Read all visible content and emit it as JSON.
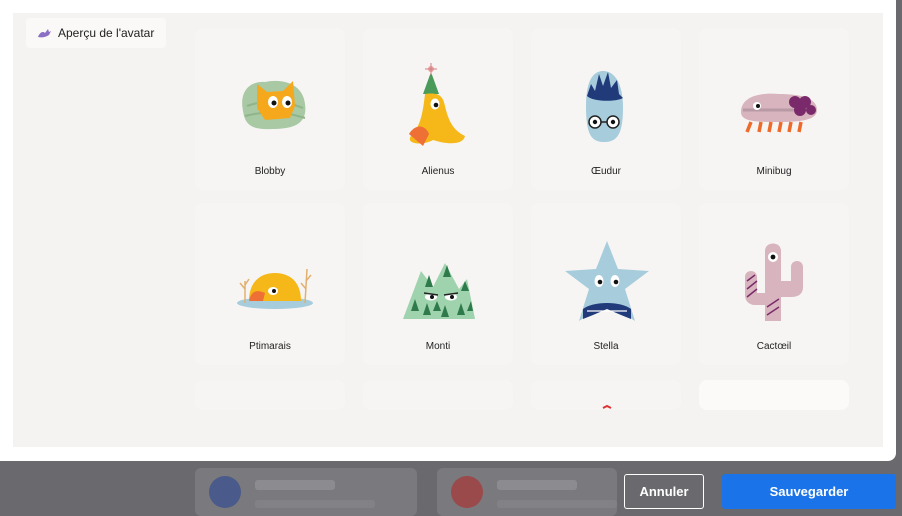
{
  "dialog": {
    "preview_label": "Aperçu de l'avatar",
    "avatars": [
      {
        "name": "Blobby",
        "icon": "blobby-avatar"
      },
      {
        "name": "Alienus",
        "icon": "alienus-avatar"
      },
      {
        "name": "Œudur",
        "icon": "oeudur-avatar"
      },
      {
        "name": "Minibug",
        "icon": "minibug-avatar"
      },
      {
        "name": "Ptimarais",
        "icon": "ptimarais-avatar"
      },
      {
        "name": "Monti",
        "icon": "monti-avatar"
      },
      {
        "name": "Stella",
        "icon": "stella-avatar"
      },
      {
        "name": "Cactœil",
        "icon": "cactoeil-avatar"
      }
    ]
  },
  "footer": {
    "cancel_label": "Annuler",
    "save_label": "Sauvegarder"
  },
  "colors": {
    "save_button": "#1a73e8",
    "tile_bg": "#f7f5f4",
    "panel_bg": "#f5f3f1"
  }
}
